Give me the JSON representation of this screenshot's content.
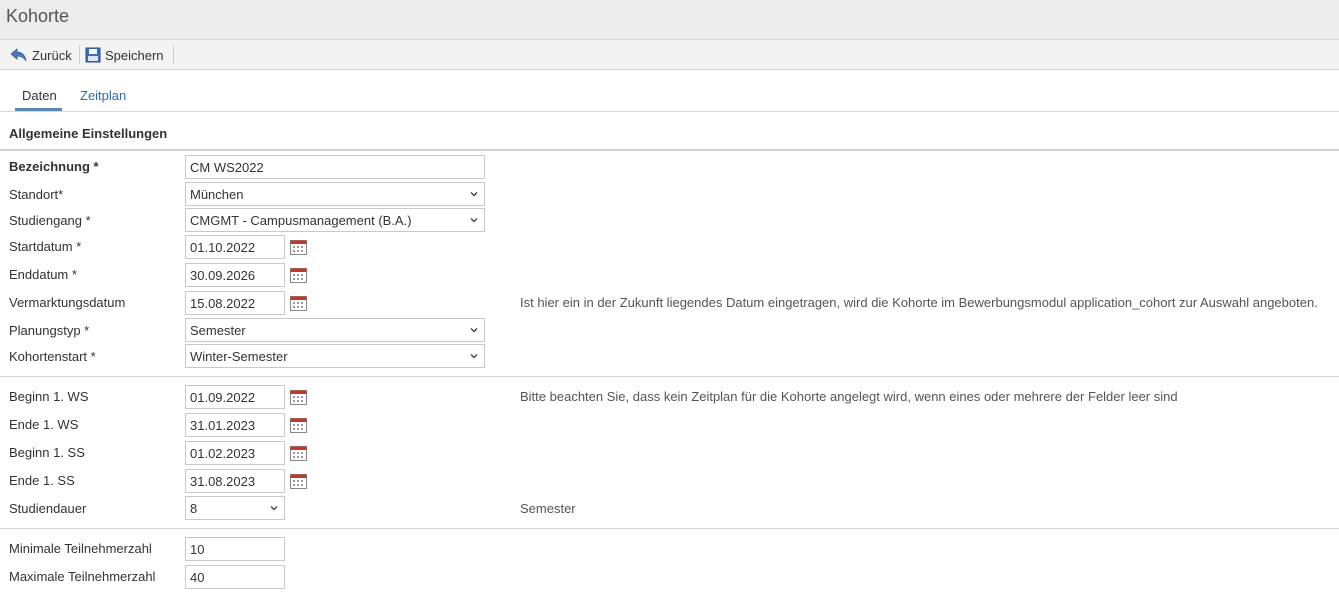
{
  "window": {
    "title": "Kohorte"
  },
  "toolbar": {
    "back_label": "Zurück",
    "save_label": "Speichern"
  },
  "tabs": [
    {
      "label": "Daten",
      "active": true
    },
    {
      "label": "Zeitplan",
      "active": false
    }
  ],
  "section": {
    "title": "Allgemeine Einstellungen"
  },
  "form": {
    "bezeichnung": {
      "label": "Bezeichnung *",
      "value": "CM WS2022"
    },
    "standort": {
      "label": "Standort*",
      "value": "München"
    },
    "studiengang": {
      "label": "Studiengang *",
      "value": "CMGMT - Campusmanagement (B.A.)"
    },
    "startdatum": {
      "label": "Startdatum *",
      "value": "01.10.2022"
    },
    "enddatum": {
      "label": "Enddatum *",
      "value": "30.09.2026"
    },
    "vermarktungsdatum": {
      "label": "Vermarktungsdatum",
      "value": "15.08.2022",
      "hint": "Ist hier ein in der Zukunft liegendes Datum eingetragen, wird die Kohorte im Bewerbungsmodul application_cohort zur Auswahl angeboten."
    },
    "planungstyp": {
      "label": "Planungstyp *",
      "value": "Semester"
    },
    "kohortenstart": {
      "label": "Kohortenstart *",
      "value": "Winter-Semester"
    },
    "beginn_ws": {
      "label": "Beginn 1. WS",
      "value": "01.09.2022",
      "hint": "Bitte beachten Sie, dass kein Zeitplan für die Kohorte angelegt wird, wenn eines oder mehrere der Felder leer sind"
    },
    "ende_ws": {
      "label": "Ende 1. WS",
      "value": "31.01.2023"
    },
    "beginn_ss": {
      "label": "Beginn 1. SS",
      "value": "01.02.2023"
    },
    "ende_ss": {
      "label": "Ende 1. SS",
      "value": "31.08.2023"
    },
    "studiendauer": {
      "label": "Studiendauer",
      "value": "8",
      "hint": "Semester"
    },
    "min_teilnehmer": {
      "label": "Minimale Teilnehmerzahl",
      "value": "10"
    },
    "max_teilnehmer": {
      "label": "Maximale Teilnehmerzahl",
      "value": "40"
    }
  },
  "icons": {
    "back": "back-arrow-icon",
    "save": "floppy-disk-icon",
    "calendar": "calendar-icon",
    "dropdown": "chevron-down-icon"
  },
  "colors": {
    "link": "#2a6ebb",
    "tab_underline": "#5a87b8",
    "titlebar_bg": "#ececec"
  }
}
